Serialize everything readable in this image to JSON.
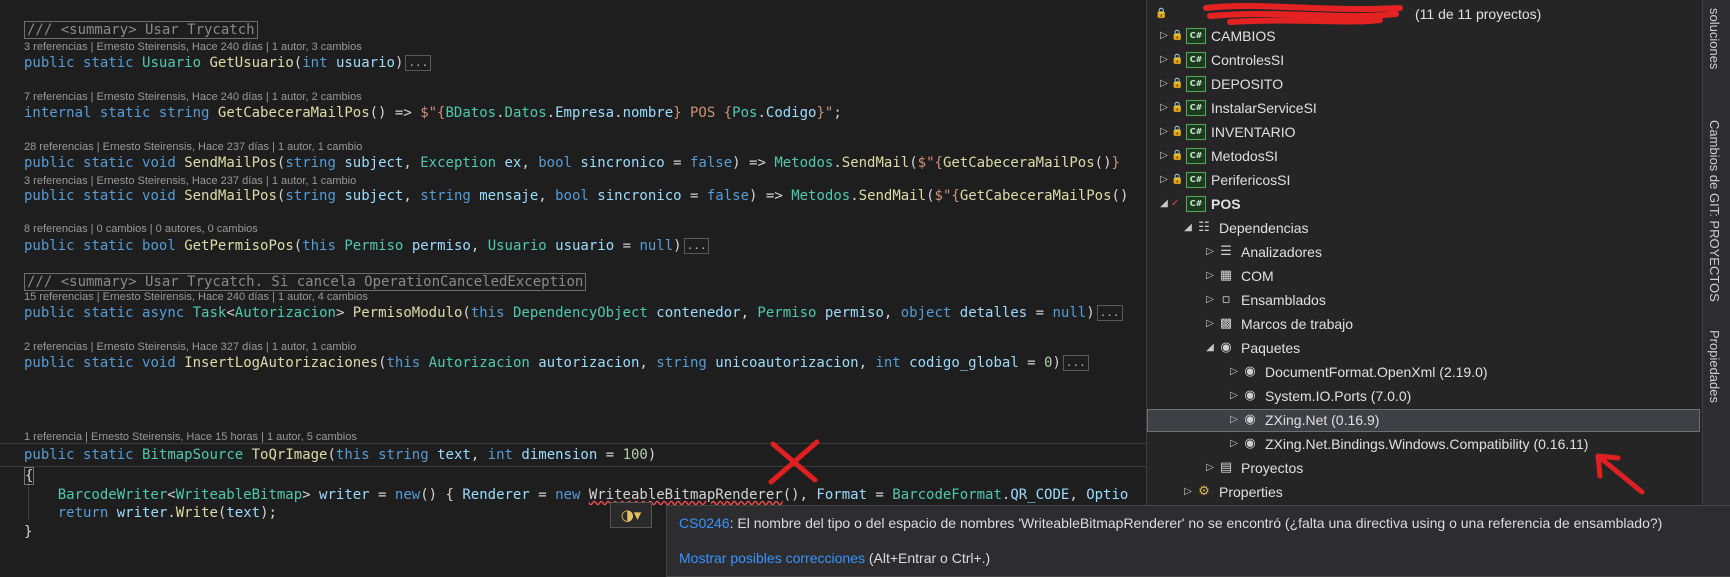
{
  "editor": {
    "lens": {
      "l1": "3 referencias | Ernesto Steirensis, Hace 240 días | 1 autor, 3 cambios",
      "l2": "7 referencias | Ernesto Steirensis, Hace 240 días | 1 autor, 2 cambios",
      "l3": "28 referencias | Ernesto Steirensis, Hace 237 días | 1 autor, 1 cambio",
      "l4": "3 referencias | Ernesto Steirensis, Hace 237 días | 1 autor, 1 cambio",
      "l5": "8 referencias | 0 cambios | 0 autores, 0 cambios",
      "l6": "15 referencias | Ernesto Steirensis, Hace 240 días | 1 autor, 4 cambios",
      "l7": "2 referencias | Ernesto Steirensis, Hace 327 días | 1 autor, 1 cambio",
      "l8": "1 referencia | Ernesto Steirensis, Hace 15 horas | 1 autor, 5 cambios"
    },
    "comments": {
      "c1": "/// <summary> Usar Trycatch",
      "c2": "/// <summary> Usar Trycatch. Si cancela OperationCanceledException"
    },
    "ellipsis": "..."
  },
  "tooltip": {
    "code": "CS0246",
    "message": ": El nombre del tipo o del espacio de nombres 'WriteableBitmapRenderer' no se encontró (¿falta una directiva using o una referencia de ensamblado?)",
    "fix_link": "Mostrar posibles correcciones",
    "shortcut": " (Alt+Entrar o Ctrl+.)"
  },
  "solution_explorer": {
    "header_suffix": "(11 de 11 proyectos)",
    "nodes": [
      {
        "label": "CAMBIOS"
      },
      {
        "label": "ControlesSI"
      },
      {
        "label": "DEPOSITO"
      },
      {
        "label": "InstalarServiceSI"
      },
      {
        "label": "INVENTARIO"
      },
      {
        "label": "MetodosSI"
      },
      {
        "label": "PerifericosSI"
      },
      {
        "label": "POS"
      },
      {
        "label": "Dependencias"
      },
      {
        "label": "Analizadores"
      },
      {
        "label": "COM"
      },
      {
        "label": "Ensamblados"
      },
      {
        "label": "Marcos de trabajo"
      },
      {
        "label": "Paquetes"
      },
      {
        "label": "DocumentFormat.OpenXml (2.19.0)"
      },
      {
        "label": "System.IO.Ports (7.0.0)"
      },
      {
        "label": "ZXing.Net (0.16.9)"
      },
      {
        "label": "ZXing.Net.Bindings.Windows.Compatibility (0.16.11)"
      },
      {
        "label": "Proyectos"
      },
      {
        "label": "Properties"
      }
    ]
  },
  "side_tabs": [
    "soluciones",
    "Cambios de GIT: PROYECTOS",
    "Propiedades"
  ],
  "colors": {
    "keyword": "#569cd6",
    "type": "#4ec9b0",
    "method": "#dcdcaa",
    "string": "#ce9178",
    "error": "#f14c4c",
    "link": "#3794ff"
  }
}
